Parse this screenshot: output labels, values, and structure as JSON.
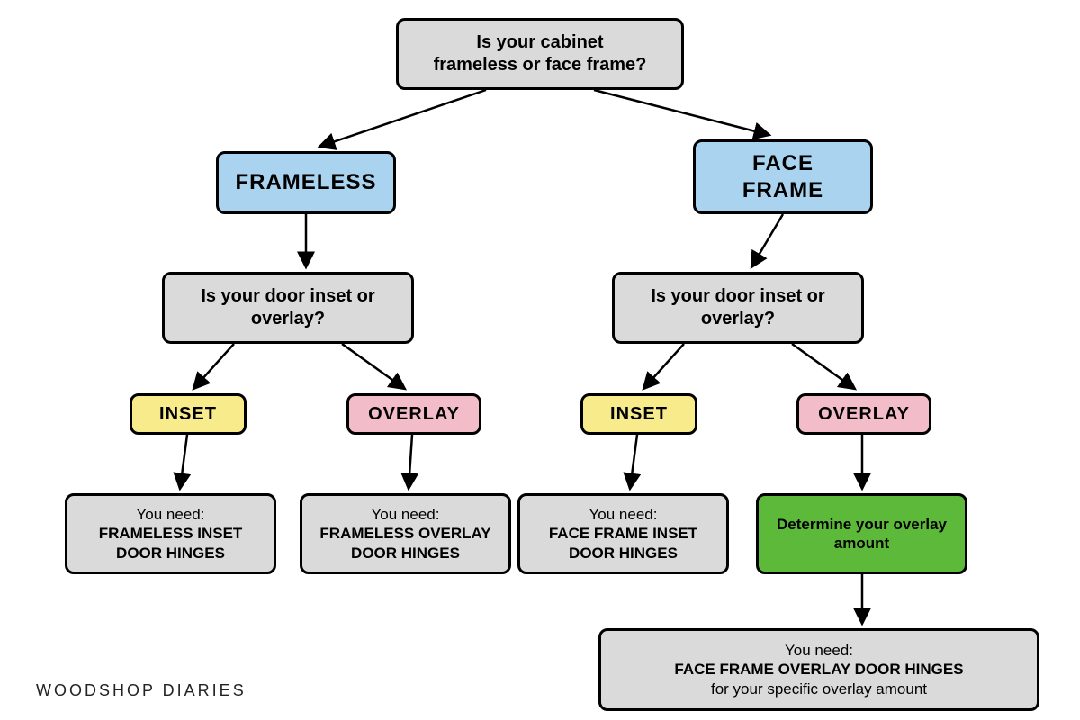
{
  "root": {
    "line1": "Is your cabinet",
    "line2": "frameless or face frame?"
  },
  "branch_left": {
    "label": "FRAMELESS",
    "question_line1": "Is your door inset or",
    "question_line2": "overlay?",
    "inset": {
      "label": "INSET",
      "result_lead": "You need:",
      "result_main": "FRAMELESS INSET DOOR HINGES"
    },
    "overlay": {
      "label": "OVERLAY",
      "result_lead": "You need:",
      "result_main": "FRAMELESS OVERLAY DOOR HINGES"
    }
  },
  "branch_right": {
    "label_line1": "FACE",
    "label_line2": "FRAME",
    "question_line1": "Is your door inset or",
    "question_line2": "overlay?",
    "inset": {
      "label": "INSET",
      "result_lead": "You need:",
      "result_main": "FACE FRAME INSET DOOR HINGES"
    },
    "overlay": {
      "label": "OVERLAY",
      "intermediate": "Determine your overlay amount",
      "result_lead": "You need:",
      "result_line2": "FACE FRAME OVERLAY DOOR HINGES",
      "result_line3": "for your specific overlay amount"
    }
  },
  "watermark": "WOODSHOP DIARIES",
  "colors": {
    "gray": "#dadada",
    "blue": "#aad3ef",
    "yellow": "#f7eb8b",
    "pink": "#f2bdc8",
    "green": "#5db93a"
  }
}
